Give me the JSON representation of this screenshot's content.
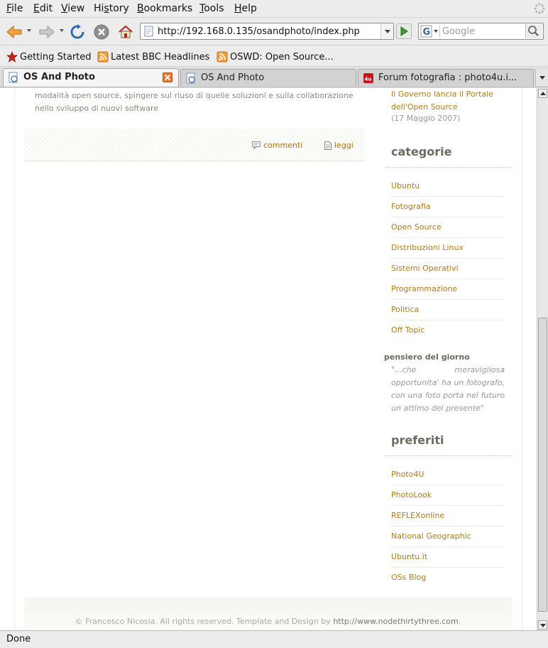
{
  "menu": [
    {
      "label": "File"
    },
    {
      "label": "Edit"
    },
    {
      "label": "View"
    },
    {
      "label": "History"
    },
    {
      "label": "Bookmarks"
    },
    {
      "label": "Tools"
    },
    {
      "label": "Help"
    }
  ],
  "navigation": {
    "url": "http://192.168.0.135/osandphoto/index.php",
    "search_placeholder": "Google",
    "search_engine_letter": "G"
  },
  "bookmarks": [
    {
      "label": "Getting Started",
      "icon": "red-star-icon"
    },
    {
      "label": "Latest BBC Headlines",
      "icon": "rss-feed-icon"
    },
    {
      "label": "OSWD: Open Source...",
      "icon": "rss-feed-icon"
    }
  ],
  "tabs": [
    {
      "label": "OS And Photo",
      "active": true
    },
    {
      "label": "OS And Photo",
      "active": false
    },
    {
      "label": "Forum fotografia : photo4u.i...",
      "active": false,
      "icon_text": "4u"
    }
  ],
  "article": {
    "text": "modalità open source, spingere sul riuso di quelle soluzioni e sulla collaborazione nello sviluppo di nuovi software",
    "comments_label": "commenti",
    "read_label": "leggi"
  },
  "sidebar": {
    "news_link": "Il Governo lancia il Portale dell'Open Source",
    "news_date": "(17 Maggio 2007)",
    "categories_title": "categorie",
    "categories": [
      "Ubuntu",
      "Fotografia",
      "Open Source",
      "Distribuzioni Linux",
      "Sistemi Operativi",
      "Programmazione",
      "Politica",
      "Off Topic"
    ],
    "thought_title": "pensiero del giorno",
    "thought_text": "\"...che meravigliosa opportunita' ha un fotografo, con una foto porta nel futuro un attimo del presente\"",
    "favorites_title": "preferiti",
    "favorites": [
      "Photo4U",
      "PhotoLook",
      "REFLEXonline",
      "National Geographic",
      "Ubuntu.it",
      "OSs Blog"
    ]
  },
  "footer": {
    "text": "© Francesco Nicosia. All rights reserved. Template and Design by ",
    "link": "http://www.nodethirtythree.com",
    "end": "."
  },
  "status": {
    "text": "Done"
  },
  "colors": {
    "link": "#b57b1a",
    "muted_text": "#999999",
    "heading": "#6b6b60",
    "tab_close": "#e9772a"
  }
}
